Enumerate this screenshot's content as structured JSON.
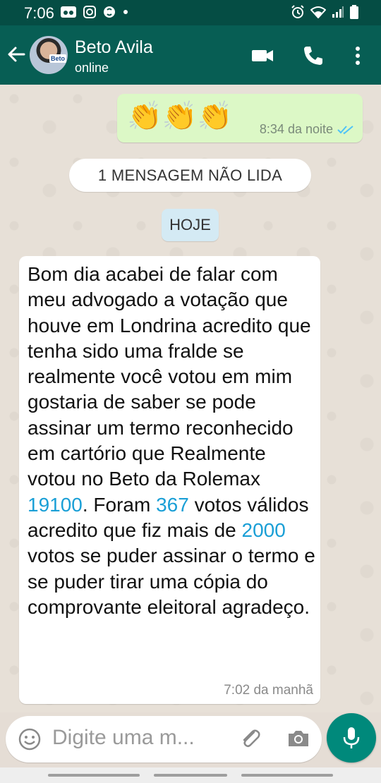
{
  "status_bar": {
    "time": "7:06",
    "left_icons": [
      "voicemail-icon",
      "instagram-icon",
      "shazam-icon",
      "dot-icon"
    ],
    "right_icons": [
      "alarm-icon",
      "wifi-icon",
      "signal-icon",
      "battery-icon"
    ]
  },
  "header": {
    "contact_name": "Beto Avila",
    "status": "online",
    "avatar_tag": "Beto",
    "actions": [
      "video-call-icon",
      "voice-call-icon",
      "more-options-icon"
    ]
  },
  "messages": {
    "outgoing": {
      "emojis": "👏👏👏",
      "time": "8:34 da noite",
      "read_status": "read-double-check"
    },
    "unread_banner": "1 MENSAGEM NÃO LIDA",
    "date_divider": "HOJE",
    "incoming": {
      "text_1": "Bom dia acabei de falar com meu advogado a votação que houve em Londrina acredito que tenha sido uma fralde se realmente você votou em mim gostaria de saber se pode assinar um termo reconhecido em cartório que Realmente votou no Beto da Rolemax ",
      "number_1": "19100",
      "text_2": ". Foram ",
      "number_2": "367",
      "text_3": " votos válidos acredito que fiz mais de ",
      "number_3": "2000",
      "text_4": " votos se puder assinar o termo e se puder tirar uma cópia do comprovante eleitoral agradeço.",
      "time": "7:02 da manhã"
    }
  },
  "composer": {
    "placeholder": "Digite uma m..."
  },
  "colors": {
    "header": "#075e54",
    "status_bar": "#054d44",
    "outgoing_bubble": "#dcf8c6",
    "link_number": "#1a9fd6",
    "mic_button": "#00897b"
  }
}
